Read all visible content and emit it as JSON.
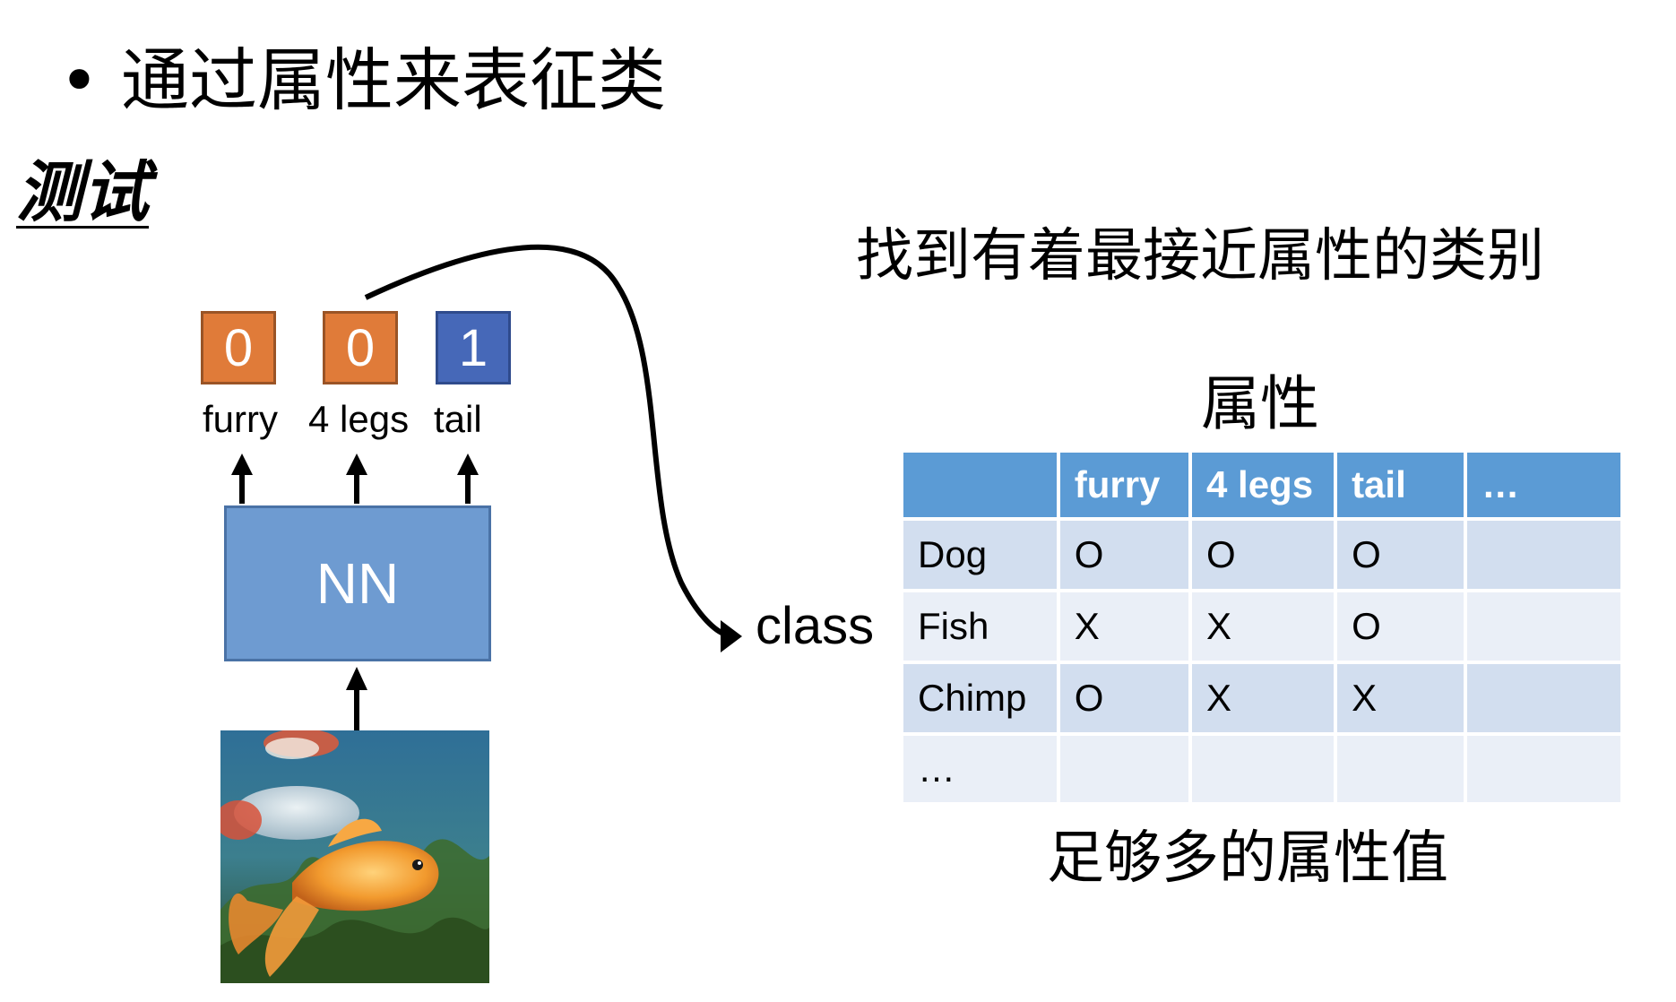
{
  "bullet": "• 通过属性来表征类",
  "test_label": "测试",
  "find_title": "找到有着最接近属性的类别",
  "attributes_title": "属性",
  "enough_label": "足够多的属性值",
  "nn_label": "NN",
  "class_label": "class",
  "output_attributes": [
    {
      "value": "0",
      "name": "furry",
      "color": "#e07b39"
    },
    {
      "value": "0",
      "name": "4 legs",
      "color": "#e07b39"
    },
    {
      "value": "1",
      "name": "tail",
      "color": "#4668b8"
    }
  ],
  "table": {
    "headers": [
      "",
      "furry",
      "4 legs",
      "tail",
      "…"
    ],
    "rows": [
      [
        "Dog",
        "O",
        "O",
        "O",
        ""
      ],
      [
        "Fish",
        "X",
        "X",
        "O",
        ""
      ],
      [
        "Chimp",
        "O",
        "X",
        "X",
        ""
      ],
      [
        "…",
        "",
        "",
        "",
        ""
      ]
    ]
  },
  "colors": {
    "nn_fill": "#6e9bd1",
    "table_header": "#5b9bd5",
    "table_row_dark": "#d2deef",
    "table_row_light": "#eaeff7"
  }
}
